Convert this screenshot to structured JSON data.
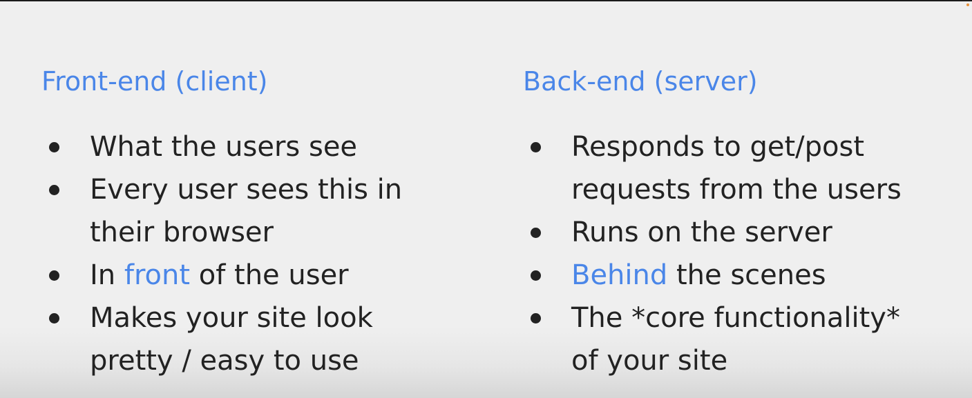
{
  "left": {
    "heading": "Front-end (client)",
    "items": [
      {
        "lines": [
          "What the users see"
        ]
      },
      {
        "lines": [
          "Every user sees this in",
          "their browser"
        ]
      },
      {
        "before": "In ",
        "accent": "front",
        "after": " of the user"
      },
      {
        "lines": [
          "Makes your site look",
          "pretty / easy to use"
        ]
      }
    ]
  },
  "right": {
    "heading": "Back-end (server)",
    "items": [
      {
        "lines": [
          "Responds to get/post",
          "requests from the users"
        ]
      },
      {
        "lines": [
          "Runs on the server"
        ]
      },
      {
        "before": "",
        "accent": "Behind",
        "after": " the scenes"
      },
      {
        "lines": [
          "The *core functionality*",
          "of your site"
        ]
      }
    ]
  },
  "colors": {
    "accent": "#4a86e8",
    "text": "#222222",
    "background": "#efefef"
  }
}
